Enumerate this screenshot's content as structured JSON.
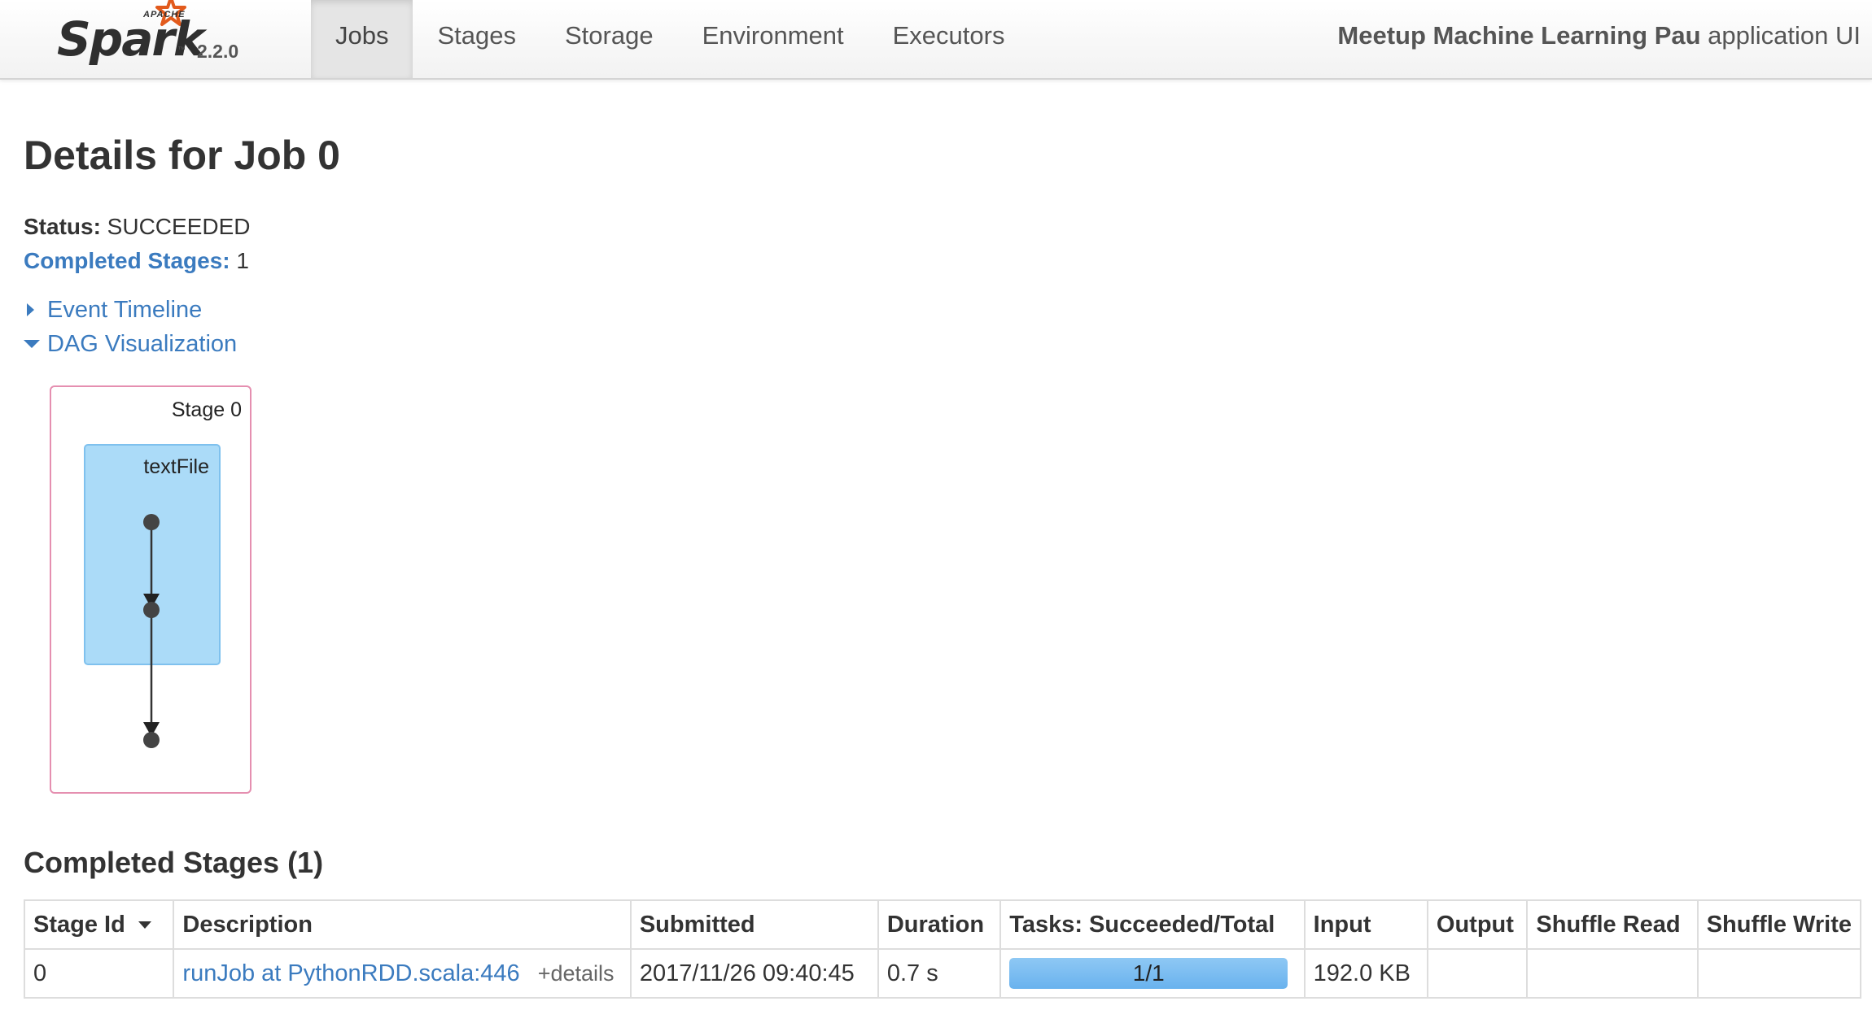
{
  "header": {
    "brand_small": "APACHE",
    "brand_name": "Spark",
    "version": "2.2.0",
    "tabs": [
      {
        "label": "Jobs",
        "active": true
      },
      {
        "label": "Stages",
        "active": false
      },
      {
        "label": "Storage",
        "active": false
      },
      {
        "label": "Environment",
        "active": false
      },
      {
        "label": "Executors",
        "active": false
      }
    ],
    "app_name": "Meetup Machine Learning Pau",
    "app_suffix": " application UI"
  },
  "page": {
    "title": "Details for Job 0",
    "status_label": "Status:",
    "status_value": " SUCCEEDED",
    "completed_label": "Completed Stages:",
    "completed_value": " 1",
    "event_timeline": "Event Timeline",
    "dag_visualization": "DAG Visualization"
  },
  "dag": {
    "stage_label": "Stage 0",
    "cluster_label": "textFile"
  },
  "completed_stages": {
    "title": "Completed Stages (1)",
    "columns": [
      "Stage Id",
      "Description",
      "Submitted",
      "Duration",
      "Tasks: Succeeded/Total",
      "Input",
      "Output",
      "Shuffle Read",
      "Shuffle Write"
    ],
    "rows": [
      {
        "stage_id": "0",
        "description": "runJob at PythonRDD.scala:446",
        "details": "+details",
        "submitted": "2017/11/26 09:40:45",
        "duration": "0.7 s",
        "tasks_text": "1/1",
        "tasks_fraction": 1.0,
        "input": "192.0 KB",
        "output": "",
        "shuffle_read": "",
        "shuffle_write": ""
      }
    ]
  },
  "colors": {
    "link": "#3b7bbf",
    "stage_border": "#e58fb0",
    "cluster_fill": "#abdbf8",
    "progress_fill": "#69b2ee"
  }
}
